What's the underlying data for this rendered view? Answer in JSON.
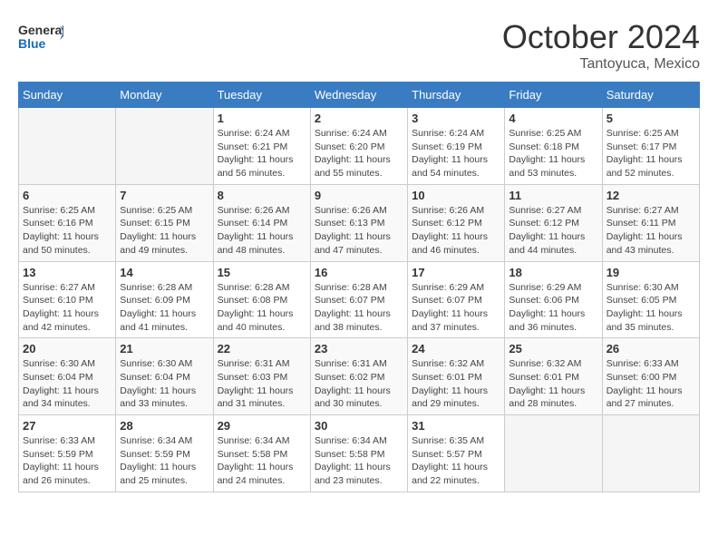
{
  "header": {
    "logo_text_general": "General",
    "logo_text_blue": "Blue",
    "month_title": "October 2024",
    "subtitle": "Tantoyuca, Mexico"
  },
  "weekdays": [
    "Sunday",
    "Monday",
    "Tuesday",
    "Wednesday",
    "Thursday",
    "Friday",
    "Saturday"
  ],
  "weeks": [
    [
      {
        "day": "",
        "empty": true
      },
      {
        "day": "",
        "empty": true
      },
      {
        "day": "1",
        "sunrise": "6:24 AM",
        "sunset": "6:21 PM",
        "daylight": "11 hours and 56 minutes."
      },
      {
        "day": "2",
        "sunrise": "6:24 AM",
        "sunset": "6:20 PM",
        "daylight": "11 hours and 55 minutes."
      },
      {
        "day": "3",
        "sunrise": "6:24 AM",
        "sunset": "6:19 PM",
        "daylight": "11 hours and 54 minutes."
      },
      {
        "day": "4",
        "sunrise": "6:25 AM",
        "sunset": "6:18 PM",
        "daylight": "11 hours and 53 minutes."
      },
      {
        "day": "5",
        "sunrise": "6:25 AM",
        "sunset": "6:17 PM",
        "daylight": "11 hours and 52 minutes."
      }
    ],
    [
      {
        "day": "6",
        "sunrise": "6:25 AM",
        "sunset": "6:16 PM",
        "daylight": "11 hours and 50 minutes."
      },
      {
        "day": "7",
        "sunrise": "6:25 AM",
        "sunset": "6:15 PM",
        "daylight": "11 hours and 49 minutes."
      },
      {
        "day": "8",
        "sunrise": "6:26 AM",
        "sunset": "6:14 PM",
        "daylight": "11 hours and 48 minutes."
      },
      {
        "day": "9",
        "sunrise": "6:26 AM",
        "sunset": "6:13 PM",
        "daylight": "11 hours and 47 minutes."
      },
      {
        "day": "10",
        "sunrise": "6:26 AM",
        "sunset": "6:12 PM",
        "daylight": "11 hours and 46 minutes."
      },
      {
        "day": "11",
        "sunrise": "6:27 AM",
        "sunset": "6:12 PM",
        "daylight": "11 hours and 44 minutes."
      },
      {
        "day": "12",
        "sunrise": "6:27 AM",
        "sunset": "6:11 PM",
        "daylight": "11 hours and 43 minutes."
      }
    ],
    [
      {
        "day": "13",
        "sunrise": "6:27 AM",
        "sunset": "6:10 PM",
        "daylight": "11 hours and 42 minutes."
      },
      {
        "day": "14",
        "sunrise": "6:28 AM",
        "sunset": "6:09 PM",
        "daylight": "11 hours and 41 minutes."
      },
      {
        "day": "15",
        "sunrise": "6:28 AM",
        "sunset": "6:08 PM",
        "daylight": "11 hours and 40 minutes."
      },
      {
        "day": "16",
        "sunrise": "6:28 AM",
        "sunset": "6:07 PM",
        "daylight": "11 hours and 38 minutes."
      },
      {
        "day": "17",
        "sunrise": "6:29 AM",
        "sunset": "6:07 PM",
        "daylight": "11 hours and 37 minutes."
      },
      {
        "day": "18",
        "sunrise": "6:29 AM",
        "sunset": "6:06 PM",
        "daylight": "11 hours and 36 minutes."
      },
      {
        "day": "19",
        "sunrise": "6:30 AM",
        "sunset": "6:05 PM",
        "daylight": "11 hours and 35 minutes."
      }
    ],
    [
      {
        "day": "20",
        "sunrise": "6:30 AM",
        "sunset": "6:04 PM",
        "daylight": "11 hours and 34 minutes."
      },
      {
        "day": "21",
        "sunrise": "6:30 AM",
        "sunset": "6:04 PM",
        "daylight": "11 hours and 33 minutes."
      },
      {
        "day": "22",
        "sunrise": "6:31 AM",
        "sunset": "6:03 PM",
        "daylight": "11 hours and 31 minutes."
      },
      {
        "day": "23",
        "sunrise": "6:31 AM",
        "sunset": "6:02 PM",
        "daylight": "11 hours and 30 minutes."
      },
      {
        "day": "24",
        "sunrise": "6:32 AM",
        "sunset": "6:01 PM",
        "daylight": "11 hours and 29 minutes."
      },
      {
        "day": "25",
        "sunrise": "6:32 AM",
        "sunset": "6:01 PM",
        "daylight": "11 hours and 28 minutes."
      },
      {
        "day": "26",
        "sunrise": "6:33 AM",
        "sunset": "6:00 PM",
        "daylight": "11 hours and 27 minutes."
      }
    ],
    [
      {
        "day": "27",
        "sunrise": "6:33 AM",
        "sunset": "5:59 PM",
        "daylight": "11 hours and 26 minutes."
      },
      {
        "day": "28",
        "sunrise": "6:34 AM",
        "sunset": "5:59 PM",
        "daylight": "11 hours and 25 minutes."
      },
      {
        "day": "29",
        "sunrise": "6:34 AM",
        "sunset": "5:58 PM",
        "daylight": "11 hours and 24 minutes."
      },
      {
        "day": "30",
        "sunrise": "6:34 AM",
        "sunset": "5:58 PM",
        "daylight": "11 hours and 23 minutes."
      },
      {
        "day": "31",
        "sunrise": "6:35 AM",
        "sunset": "5:57 PM",
        "daylight": "11 hours and 22 minutes."
      },
      {
        "day": "",
        "empty": true
      },
      {
        "day": "",
        "empty": true
      }
    ]
  ],
  "labels": {
    "sunrise": "Sunrise:",
    "sunset": "Sunset:",
    "daylight": "Daylight:"
  }
}
